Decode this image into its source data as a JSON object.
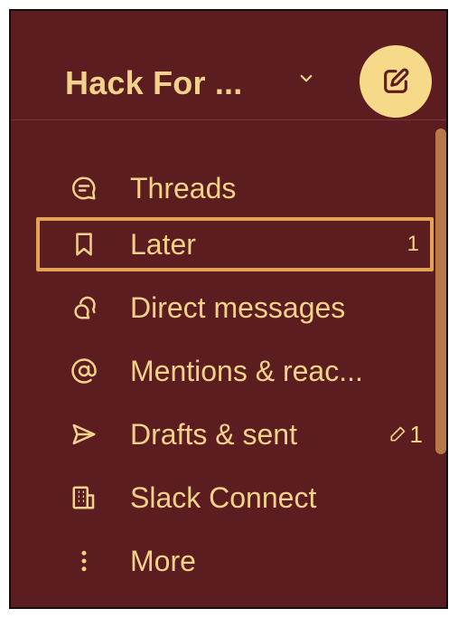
{
  "header": {
    "workspace_name": "Hack For ..."
  },
  "icons": {
    "chevron": "chevron-down-icon",
    "compose": "compose-icon"
  },
  "colors": {
    "sidebar_bg": "#5b1d1f",
    "text": "#f2d28a",
    "compose_bg": "#f7d98a",
    "selected_outline": "#e1a256",
    "scrollbar": "#b7794a"
  },
  "sidebar": {
    "items": [
      {
        "label": "Threads",
        "icon": "threads-icon"
      },
      {
        "label": "Later",
        "icon": "bookmark-icon",
        "count": "1"
      },
      {
        "label": "Direct messages",
        "icon": "direct-messages-icon"
      },
      {
        "label": "Mentions & reac...",
        "icon": "at-icon"
      },
      {
        "label": "Drafts & sent",
        "icon": "send-icon",
        "draft_count": "1"
      },
      {
        "label": "Slack Connect",
        "icon": "building-icon"
      },
      {
        "label": "More",
        "icon": "more-icon"
      }
    ]
  }
}
